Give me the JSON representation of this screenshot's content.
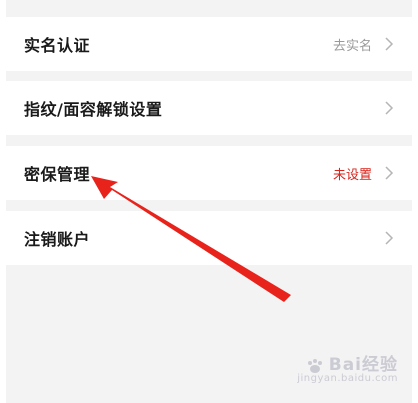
{
  "rows": [
    {
      "label": "实名认证",
      "value": "去实名",
      "value_color": "#9a9a9a"
    },
    {
      "label": "指纹/面容解锁设置",
      "value": "",
      "value_color": "#9a9a9a"
    },
    {
      "label": "密保管理",
      "value": "未设置",
      "value_color": "#d9241c"
    },
    {
      "label": "注销账户",
      "value": "",
      "value_color": "#9a9a9a"
    }
  ],
  "icons": {
    "row_chevron": "chevron-right-icon",
    "annotation": "red-arrow-icon",
    "watermark_logo": "baidu-paw-icon"
  },
  "watermark": {
    "brand": "Bai经验",
    "site": "jingyan.baidu.com"
  },
  "colors": {
    "background": "#f3f3f4",
    "row_background": "#ffffff",
    "alert": "#d9241c",
    "arrow": "#e8231c"
  }
}
